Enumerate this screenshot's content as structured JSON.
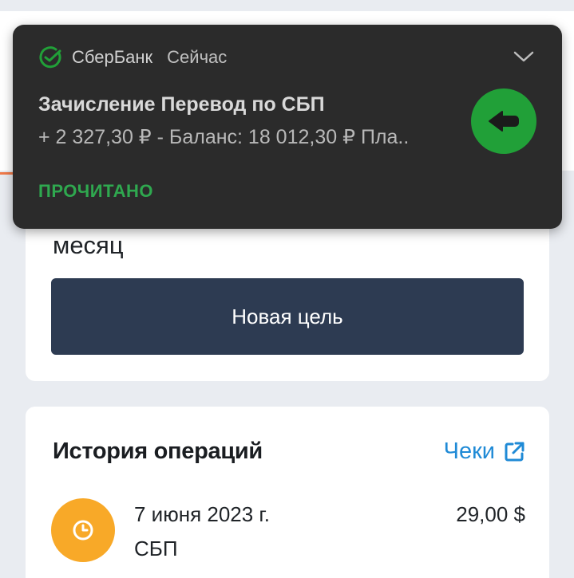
{
  "notification": {
    "app_name": "СберБанк",
    "time": "Сейчас",
    "title": "Зачисление Перевод по СБП",
    "body": "+ 2 327,30 ₽ - Баланс: 18 012,30 ₽ Пла..",
    "action": "ПРОЧИТАНО",
    "icons": {
      "app": "sber-logo-icon",
      "expand": "chevron-down-icon",
      "avatar": "arrow-left-icon"
    },
    "colors": {
      "background": "#2b2b2b",
      "accent": "#21a038",
      "action": "#2fa84f"
    }
  },
  "goal_card": {
    "text": "месяц",
    "button_label": "Новая цель"
  },
  "history": {
    "title": "История операций",
    "receipts_label": "Чеки",
    "receipts_icon": "external-link-icon",
    "operations": [
      {
        "date": "7 июня 2023 г.",
        "type": "СБП",
        "amount": "29,00 $",
        "icon": "clock-icon"
      }
    ]
  },
  "colors": {
    "page_bg": "#e9ecf1",
    "button_bg": "#2d3b52",
    "link": "#1f8ad6",
    "operation_icon_bg": "#f8a928"
  }
}
